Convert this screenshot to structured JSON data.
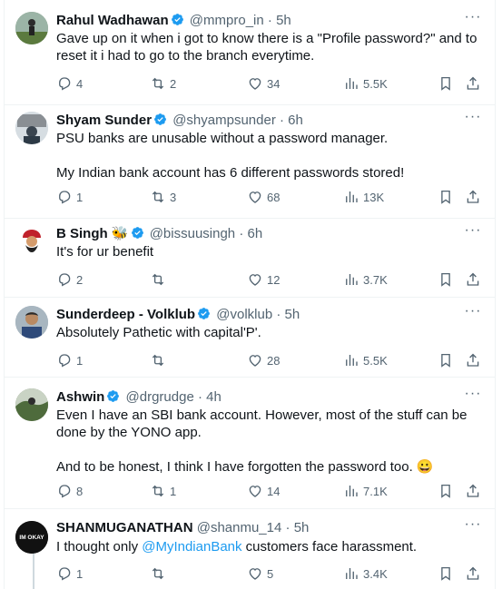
{
  "tweets": [
    {
      "name": "Rahul Wadhawan",
      "handle": "@mmpro_in",
      "time": "5h",
      "verified": true,
      "text": [
        "Gave up on it when i got to know there is a \"Profile password?\" and to reset it i had to go to the branch everytime."
      ],
      "replies": "4",
      "retweets": "2",
      "likes": "34",
      "views": "5.5K"
    },
    {
      "name": "Shyam Sunder",
      "handle": "@shyampsunder",
      "time": "6h",
      "verified": true,
      "text": [
        "PSU banks are unusable without a password manager.",
        "My Indian bank account has 6 different passwords stored!"
      ],
      "replies": "1",
      "retweets": "3",
      "likes": "68",
      "views": "13K"
    },
    {
      "name": "B Singh",
      "emoji": "🐝",
      "handle": "@bissuusingh",
      "time": "6h",
      "verified": true,
      "text": [
        "It's for ur benefit"
      ],
      "replies": "2",
      "retweets": "",
      "likes": "12",
      "views": "3.7K"
    },
    {
      "name": "Sunderdeep - Volklub",
      "handle": "@volklub",
      "time": "5h",
      "verified": true,
      "text": [
        "Absolutely Pathetic with capital'P'."
      ],
      "replies": "1",
      "retweets": "",
      "likes": "28",
      "views": "5.5K"
    },
    {
      "name": "Ashwin",
      "handle": "@drgrudge",
      "time": "4h",
      "verified": true,
      "text": [
        "Even I have an SBI bank account. However, most of the stuff can be done by the YONO app.",
        "And to be honest, I think I have forgotten the password too. 😀"
      ],
      "replies": "8",
      "retweets": "1",
      "likes": "14",
      "views": "7.1K"
    },
    {
      "name": "SHANMUGANATHAN",
      "handle": "@shanmu_14",
      "time": "5h",
      "verified": false,
      "text_prefix": "I thought only ",
      "text_mention": "@MyIndianBank",
      "text_suffix": " customers face harassment.",
      "replies": "1",
      "retweets": "",
      "likes": "5",
      "views": "3.4K",
      "avatar_text": "IM OKAY"
    }
  ],
  "ui": {
    "separator": "·",
    "more_label": "···"
  },
  "colors": {
    "text": "#0f1419",
    "secondary": "#536471",
    "accent": "#1d9bf0",
    "border": "#eff3f4"
  },
  "icons": [
    "verified-badge-icon",
    "more-icon",
    "reply-icon",
    "retweet-icon",
    "like-icon",
    "views-icon",
    "bookmark-icon",
    "share-icon"
  ]
}
